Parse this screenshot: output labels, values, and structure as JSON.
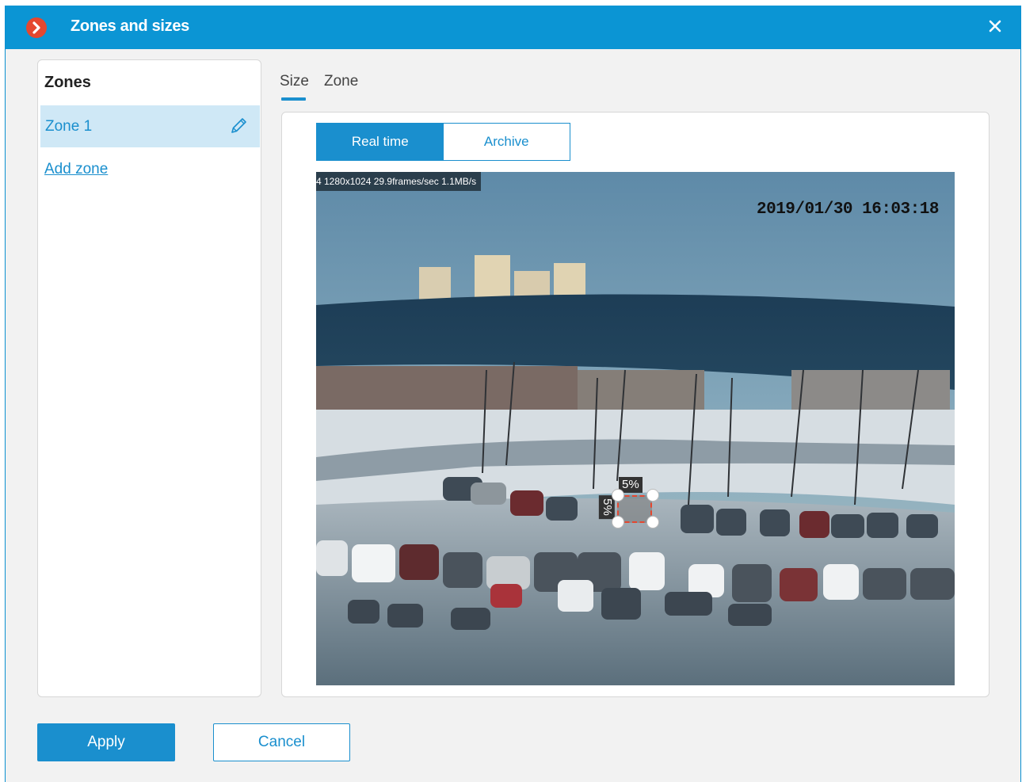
{
  "window": {
    "title": "Zones and sizes",
    "accent_color": "#0b95d4",
    "close_icon": "close-icon"
  },
  "zones_panel": {
    "header": "Zones",
    "items": [
      {
        "label": "Zone 1",
        "selected": true,
        "icon": "pencil-icon"
      }
    ],
    "add_zone_label": "Add zone"
  },
  "tabs": [
    {
      "label": "Size",
      "active": true
    },
    {
      "label": "Zone",
      "active": false
    }
  ],
  "mode_toggle": {
    "options": [
      "Real time",
      "Archive"
    ],
    "selected": "Real time"
  },
  "video": {
    "stream_info": "4 1280x1024 29.9frames/sec 1.1MB/s",
    "timestamp": "2019/01/30 16:03:18",
    "size_width_label": "5%",
    "size_height_label": "5%"
  },
  "footer": {
    "apply_label": "Apply",
    "cancel_label": "Cancel"
  }
}
